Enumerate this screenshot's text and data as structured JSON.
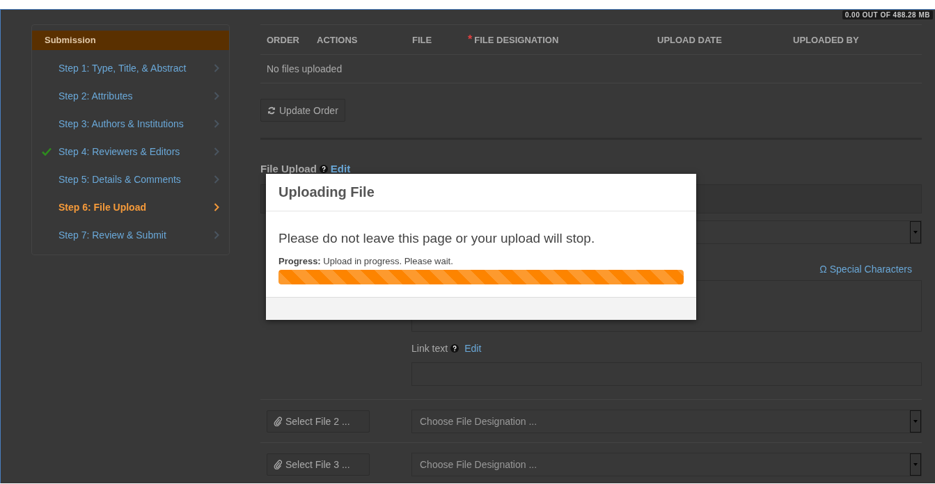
{
  "storage_badge": "0.00 OUT OF 488.28 MB",
  "sidebar": {
    "title": "Submission",
    "items": [
      {
        "label": "Step 1: Type, Title, & Abstract",
        "selected": false,
        "completed": false
      },
      {
        "label": "Step 2: Attributes",
        "selected": false,
        "completed": false
      },
      {
        "label": "Step 3: Authors & Institutions",
        "selected": false,
        "completed": false
      },
      {
        "label": "Step 4: Reviewers & Editors",
        "selected": false,
        "completed": true
      },
      {
        "label": "Step 5: Details & Comments",
        "selected": false,
        "completed": false
      },
      {
        "label": "Step 6: File Upload",
        "selected": true,
        "completed": false
      },
      {
        "label": "Step 7: Review & Submit",
        "selected": false,
        "completed": false
      }
    ]
  },
  "files_table": {
    "columns": [
      {
        "label": "ORDER"
      },
      {
        "label": "ACTIONS"
      },
      {
        "label": "FILE"
      },
      {
        "label": "FILE DESIGNATION",
        "required_mark": "*"
      },
      {
        "label": "UPLOAD DATE"
      },
      {
        "label": "UPLOADED BY"
      }
    ],
    "empty_message": "No files uploaded"
  },
  "update_order_button": "Update Order",
  "file_upload": {
    "title": "File Upload",
    "edit_link": "Edit",
    "special_characters_link": "Ω Special Characters",
    "link_text_label": "Link text",
    "link_text_edit": "Edit"
  },
  "file_rows": [
    {
      "button": "Select File 2 ...",
      "designation_placeholder": "Choose File Designation ..."
    },
    {
      "button": "Select File 3 ...",
      "designation_placeholder": "Choose File Designation ..."
    }
  ],
  "modal": {
    "title": "Uploading File",
    "message": "Please do not leave this page or your upload will stop.",
    "progress_label": "Progress:",
    "progress_status": "Upload in progress. Please wait.",
    "level": 1
  }
}
